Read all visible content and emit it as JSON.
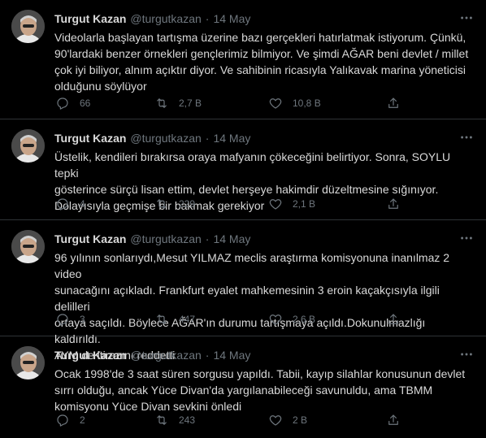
{
  "author": {
    "name": "Turgut Kazan",
    "handle": "@turgutkazan",
    "separator": "·"
  },
  "colors": {
    "background": "#000000",
    "text": "#d9d9d9",
    "muted": "#6e767d",
    "divider": "#2f3336"
  },
  "icons": {
    "more": "more-icon",
    "reply": "reply-icon",
    "retweet": "retweet-icon",
    "like": "heart-icon",
    "share": "share-icon"
  },
  "tweets": [
    {
      "date": "14 May",
      "text": "Videolarla başlayan tartışma üzerine bazı gerçekleri hatırlatmak istiyorum. Çünkü,\n90'lardaki benzer örnekleri gençlerimiz bilmiyor. Ve şimdi AĞAR beni devlet / millet\nçok iyi biliyor, alnım açıktır diyor. Ve sahibinin ricasıyla Yalıkavak marina yöneticisi\nolduğunu söylüyor",
      "replies": "66",
      "retweets": "2,7 B",
      "likes": "10,8 B"
    },
    {
      "date": "14 May",
      "text": "Üstelik, kendileri bırakırsa oraya mafyanın çökeceğini belirtiyor. Sonra, SOYLU tepki\ngösterince sürçü lisan ettim, devlet herşeye hakimdir düzeltmesine sığınıyor.\nDolayısıyla geçmişe bir bakmak gerekiyor",
      "replies": "4",
      "retweets": "229",
      "likes": "2,1 B"
    },
    {
      "date": "14 May",
      "text": "96 yılının sonlarıydı,Mesut YILMAZ meclis araştırma komisyonuna inanılmaz 2 video\nsunacağını açıkladı. Frankfurt eyalet mahkemesinin 3 eroin kaçakçısıyla ilgili delilleri\nortaya saçıldı. Böylece AĞAR'ın durumu tartışmaya açıldı.Dokunulmazlığı kaldırıldı.\nAYM de itirazını reddetti",
      "replies": "3",
      "retweets": "447",
      "likes": "2,6 B"
    },
    {
      "date": "14 May",
      "text": "Ocak 1998'de 3 saat süren sorgusu yapıldı. Tabii, kayıp silahlar konusunun devlet\nsırrı olduğu, ancak Yüce Divan'da yargılanabileceği savunuldu, ama TBMM\nkomisyonu Yüce Divan sevkini önledi",
      "replies": "2",
      "retweets": "243",
      "likes": "2 B"
    }
  ]
}
